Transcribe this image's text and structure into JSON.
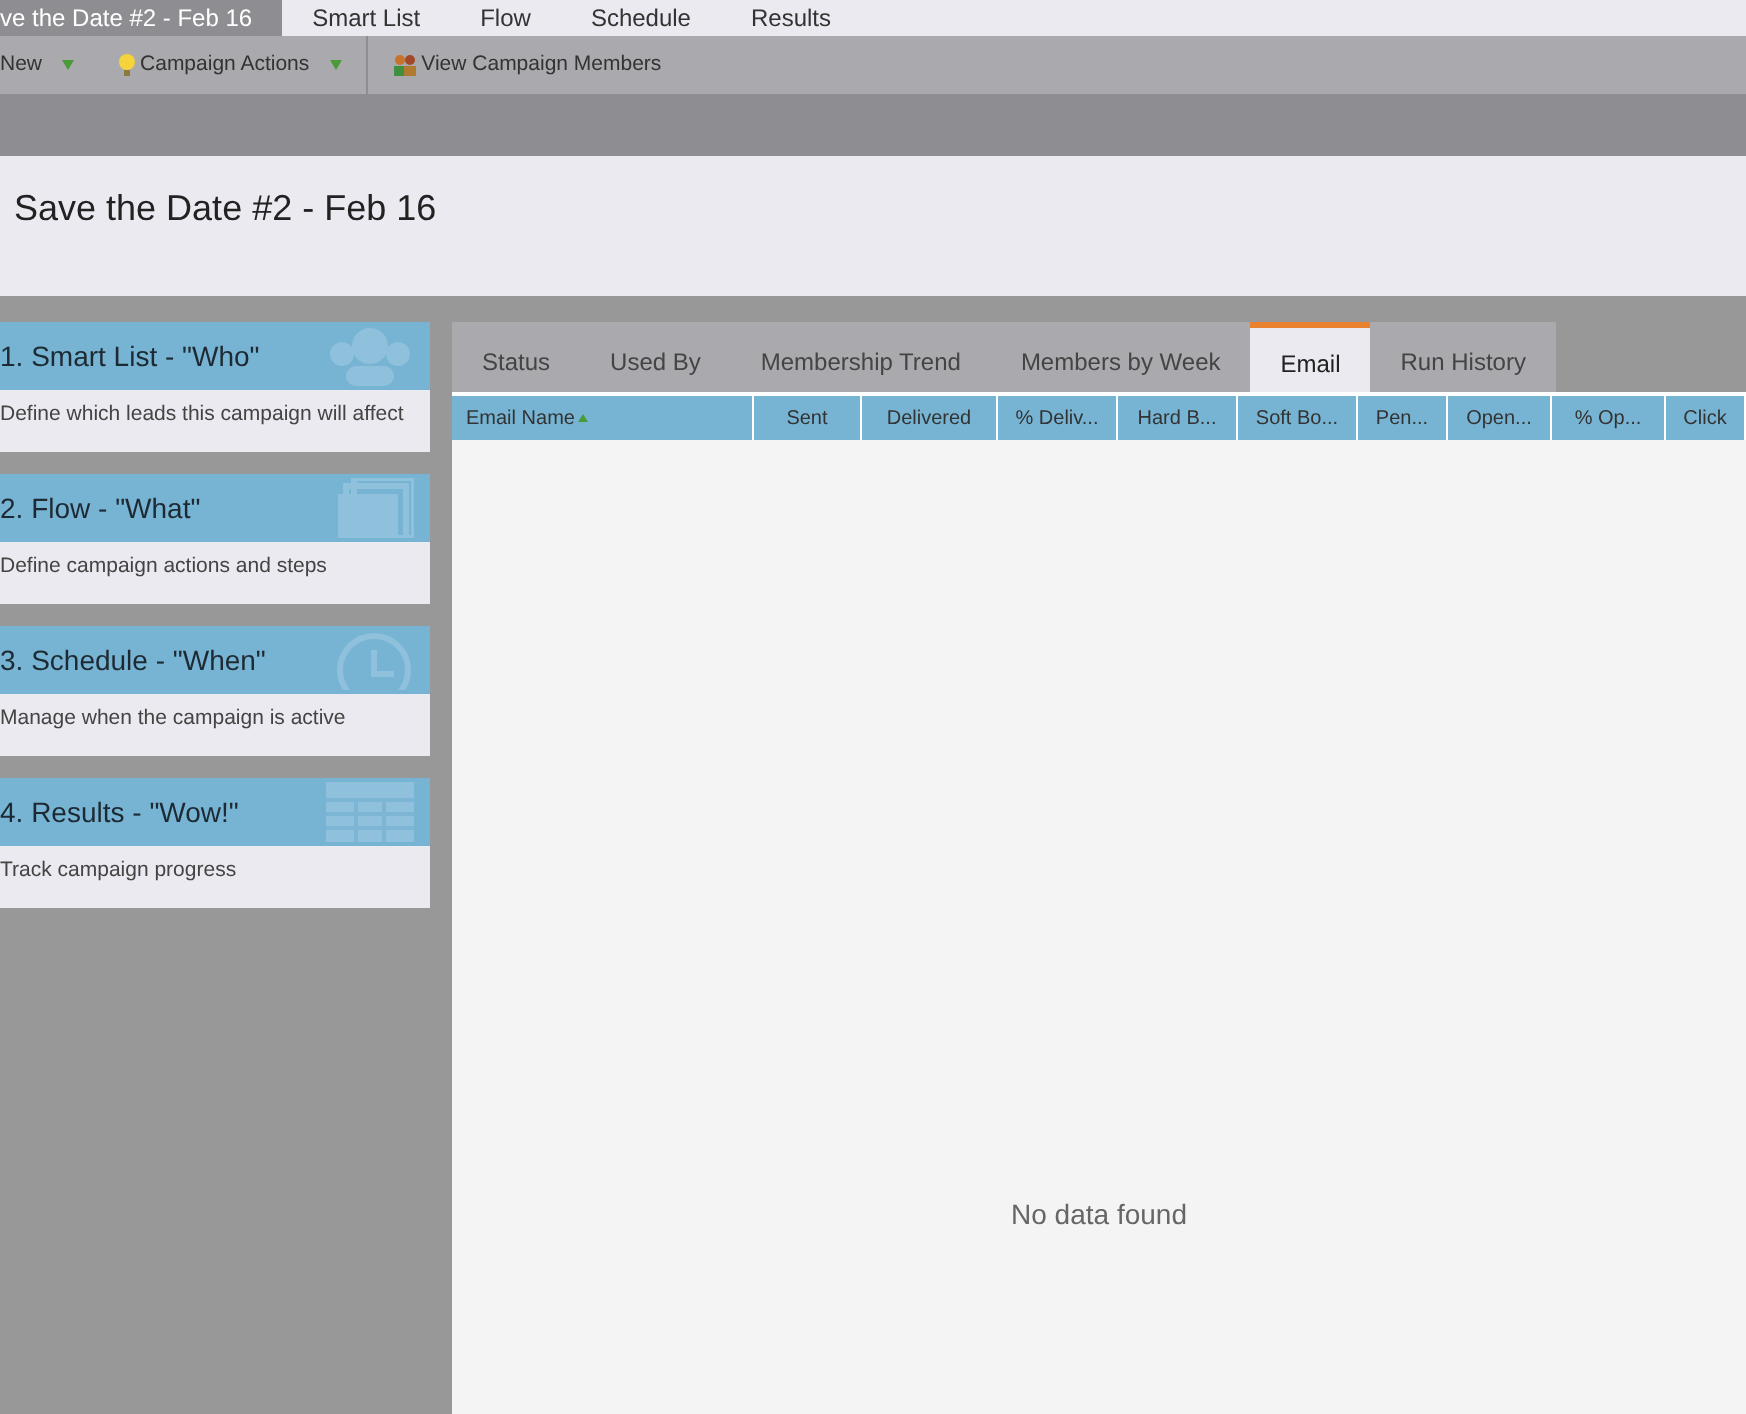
{
  "top_tabs": [
    {
      "label": "ve the Date #2 - Feb 16",
      "selected": true
    },
    {
      "label": "Smart List",
      "selected": false
    },
    {
      "label": "Flow",
      "selected": false
    },
    {
      "label": "Schedule",
      "selected": false
    },
    {
      "label": "Results",
      "selected": false
    }
  ],
  "toolbar": [
    {
      "label": "New",
      "kind": "dropdown"
    },
    {
      "label": "Campaign Actions",
      "kind": "bulb-dropdown"
    },
    {
      "label": "View Campaign Members",
      "kind": "people"
    }
  ],
  "title": "Save the Date #2 - Feb 16",
  "cards": [
    {
      "title": "1. Smart List - \"Who\"",
      "description": "Define which leads this campaign will affect",
      "kind": "people"
    },
    {
      "title": "2. Flow - \"What\"",
      "description": "Define campaign actions and steps",
      "kind": "pages"
    },
    {
      "title": "3. Schedule - \"When\"",
      "description": "Manage when the campaign is active",
      "kind": "clock"
    },
    {
      "title": "4. Results - \"Wow!\"",
      "description": "Track campaign progress",
      "kind": "table"
    }
  ],
  "tabs": [
    {
      "label": "Status",
      "selected": false
    },
    {
      "label": "Used By",
      "selected": false
    },
    {
      "label": "Membership Trend",
      "selected": false
    },
    {
      "label": "Members by Week",
      "selected": false
    },
    {
      "label": "Email",
      "selected": true
    },
    {
      "label": "Run History",
      "selected": false
    }
  ],
  "table": {
    "columns": [
      {
        "label": "Email Name",
        "sorted": true
      },
      {
        "label": "Sent",
        "sorted": false
      },
      {
        "label": "Delivered",
        "sorted": false
      },
      {
        "label": "% Deliv...",
        "sorted": false
      },
      {
        "label": "Hard B...",
        "sorted": false
      },
      {
        "label": "Soft Bo...",
        "sorted": false
      },
      {
        "label": "Pen...",
        "sorted": false
      },
      {
        "label": "Open...",
        "sorted": false
      },
      {
        "label": "% Op...",
        "sorted": false
      },
      {
        "label": "Click",
        "sorted": false
      }
    ],
    "empty_message": "No data found"
  }
}
